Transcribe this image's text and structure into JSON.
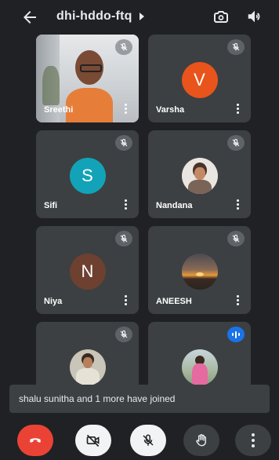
{
  "meeting": {
    "code": "dhi-hddo-ftq"
  },
  "icons": {
    "back": "arrow-left-icon",
    "flip": "camera-flip-icon",
    "speaker": "speaker-icon",
    "muted": "mic-off-icon",
    "speaking": "speaking-indicator-icon",
    "more": "more-vert-icon"
  },
  "participants": [
    {
      "name": "Sreethi",
      "type": "video",
      "muted": true
    },
    {
      "name": "Varsha",
      "type": "initial",
      "initial": "V",
      "color": "#e8541c",
      "muted": true
    },
    {
      "name": "Sifi",
      "type": "initial",
      "initial": "S",
      "color": "#12a3b8",
      "muted": true
    },
    {
      "name": "Nandana",
      "type": "photo",
      "muted": true
    },
    {
      "name": "Niya",
      "type": "initial",
      "initial": "N",
      "color": "#6d4030",
      "muted": true
    },
    {
      "name": "ANEESH",
      "type": "photo",
      "muted": true
    },
    {
      "name": "",
      "type": "photo",
      "muted": true
    },
    {
      "name": "",
      "type": "photo",
      "speaking": true
    }
  ],
  "toast": {
    "message": "shalu sunitha and 1 more have joined"
  },
  "controls": {
    "end_call_color": "#ea4335",
    "buttons": [
      "end-call",
      "camera-off",
      "mic-off",
      "raise-hand",
      "more-options"
    ]
  }
}
